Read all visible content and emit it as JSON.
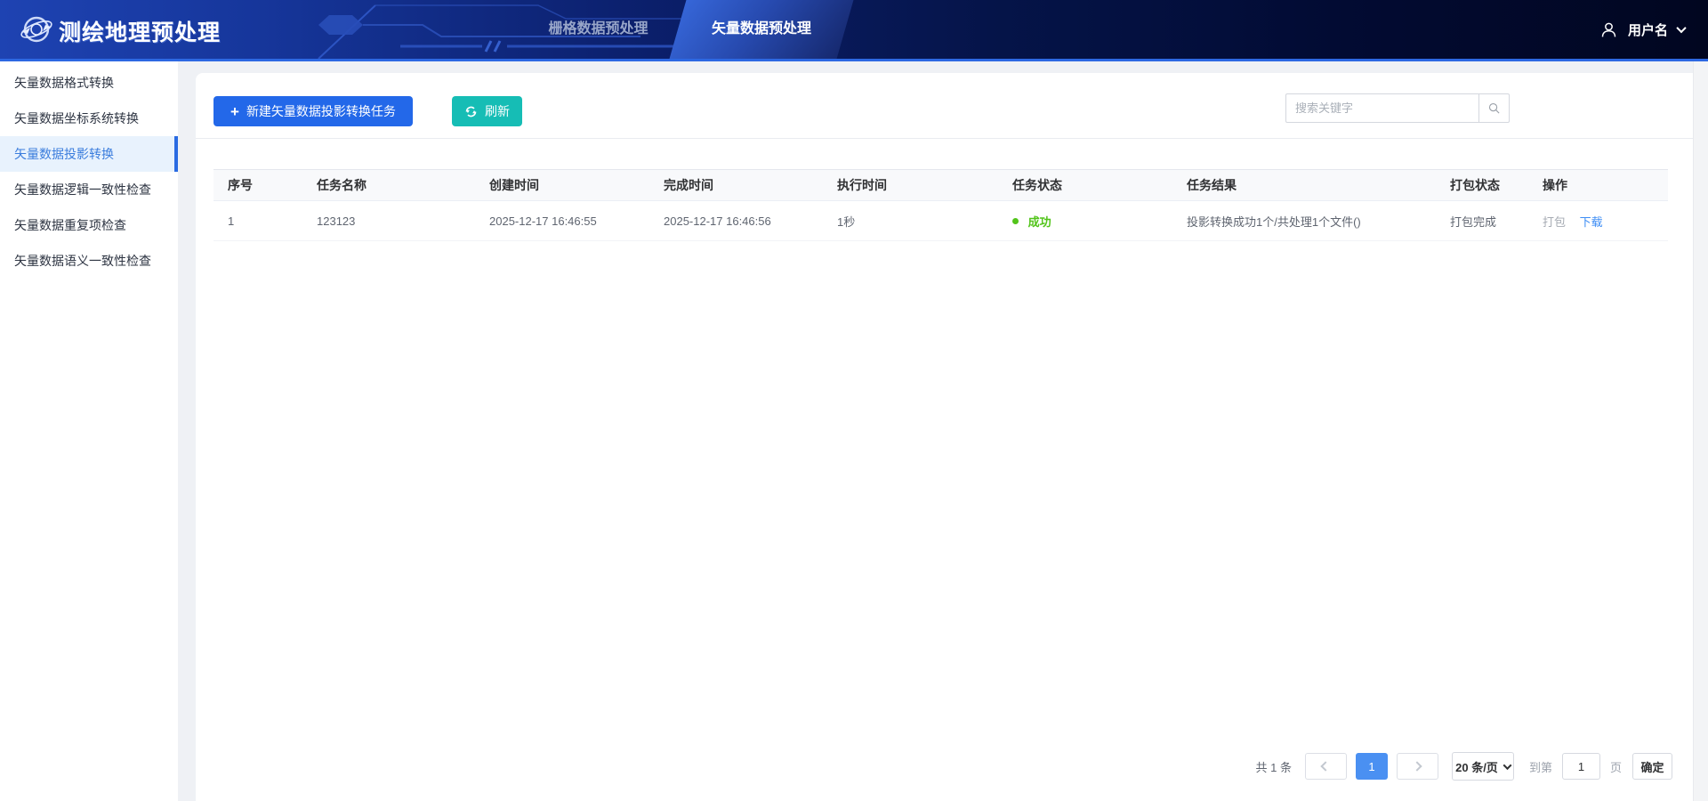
{
  "header": {
    "app_title": "测绘地理预处理",
    "tabs": [
      {
        "label": "栅格数据预处理",
        "active": false
      },
      {
        "label": "矢量数据预处理",
        "active": true
      }
    ],
    "user": {
      "name": "用户名"
    }
  },
  "sidebar": {
    "items": [
      {
        "label": "矢量数据格式转换",
        "active": false
      },
      {
        "label": "矢量数据坐标系统转换",
        "active": false
      },
      {
        "label": "矢量数据投影转换",
        "active": true
      },
      {
        "label": "矢量数据逻辑一致性检查",
        "active": false
      },
      {
        "label": "矢量数据重复项检查",
        "active": false
      },
      {
        "label": "矢量数据语义一致性检查",
        "active": false
      }
    ]
  },
  "toolbar": {
    "new_task_label": "新建矢量数据投影转换任务",
    "refresh_label": "刷新",
    "search_placeholder": "搜索关键字"
  },
  "table": {
    "columns": [
      "序号",
      "任务名称",
      "创建时间",
      "完成时间",
      "执行时间",
      "任务状态",
      "任务结果",
      "打包状态",
      "操作"
    ],
    "rows": [
      {
        "seq": "1",
        "name": "123123",
        "created": "2025-12-17 16:46:55",
        "finished": "2025-12-17 16:46:56",
        "duration": "1秒",
        "status": "成功",
        "result": "投影转换成功1个/共处理1个文件()",
        "package_status": "打包完成",
        "op_package": "打包",
        "op_download": "下载"
      }
    ]
  },
  "pagination": {
    "total_label": "共 1 条",
    "current_page": "1",
    "page_size_label": "20 条/页",
    "goto_prefix": "到第",
    "goto_value": "1",
    "goto_suffix": "页",
    "confirm_label": "确定"
  },
  "icons": {
    "logo": "globe-orbit",
    "new_task": "plus",
    "refresh": "circular-arrows",
    "search": "magnifier",
    "user": "person-outline",
    "user_menu": "chevron-down",
    "pager_prev": "chevron-left",
    "pager_next": "chevron-right"
  },
  "colors": {
    "header_accent": "#2d68e2",
    "primary_blue": "#2368e9",
    "refresh_teal": "#16bdb5",
    "success_green": "#52c41a",
    "link_blue": "#3d8df5",
    "active_page_blue": "#4a90f2",
    "sidebar_active_bg": "#e8f2fd"
  }
}
